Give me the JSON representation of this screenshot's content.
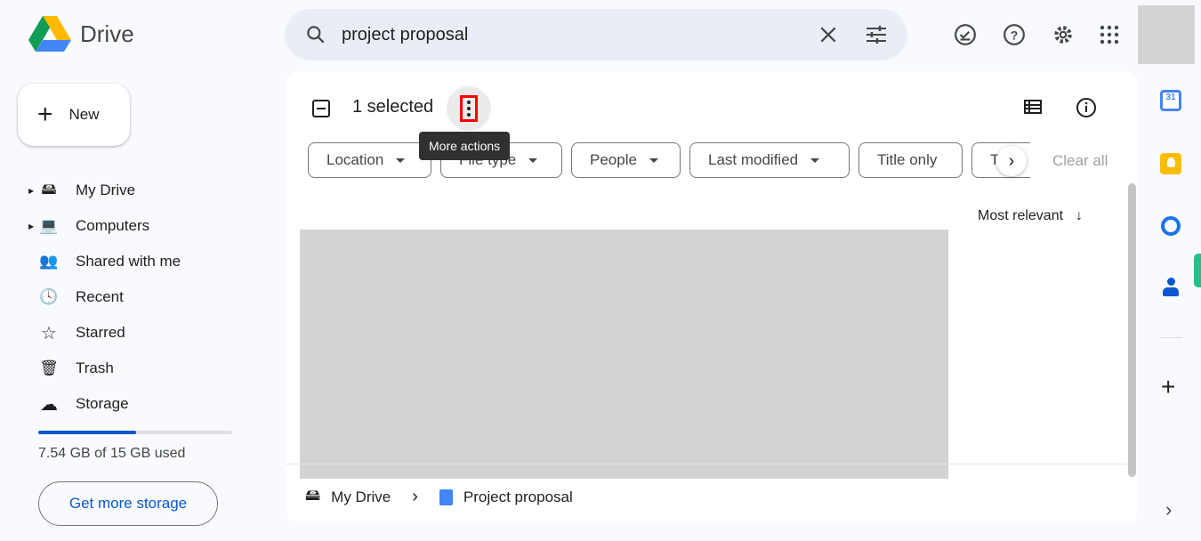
{
  "app": {
    "name": "Drive"
  },
  "search": {
    "query": "project proposal"
  },
  "new_button": "New",
  "sidebar": {
    "items": [
      {
        "label": "My Drive",
        "icon": "my-drive-icon",
        "expandable": true
      },
      {
        "label": "Computers",
        "icon": "computers-icon",
        "expandable": true
      },
      {
        "label": "Shared with me",
        "icon": "people-icon"
      },
      {
        "label": "Recent",
        "icon": "clock-icon"
      },
      {
        "label": "Starred",
        "icon": "star-icon"
      },
      {
        "label": "Trash",
        "icon": "trash-icon"
      },
      {
        "label": "Storage",
        "icon": "cloud-icon"
      }
    ]
  },
  "storage": {
    "used_text": "7.54 GB of 15 GB used",
    "used_percent": 50.3,
    "button": "Get more storage"
  },
  "selection": {
    "label": "1 selected",
    "tooltip": "More actions"
  },
  "filters": [
    "Location",
    "File type",
    "People",
    "Last modified",
    "Title only",
    "Type"
  ],
  "clear_all": "Clear all",
  "sort": {
    "label": "Most relevant"
  },
  "breadcrumb": {
    "root": "My Drive",
    "file": "Project proposal"
  },
  "colors": {
    "accent": "#0b57d0",
    "highlight": "#ff0000"
  }
}
